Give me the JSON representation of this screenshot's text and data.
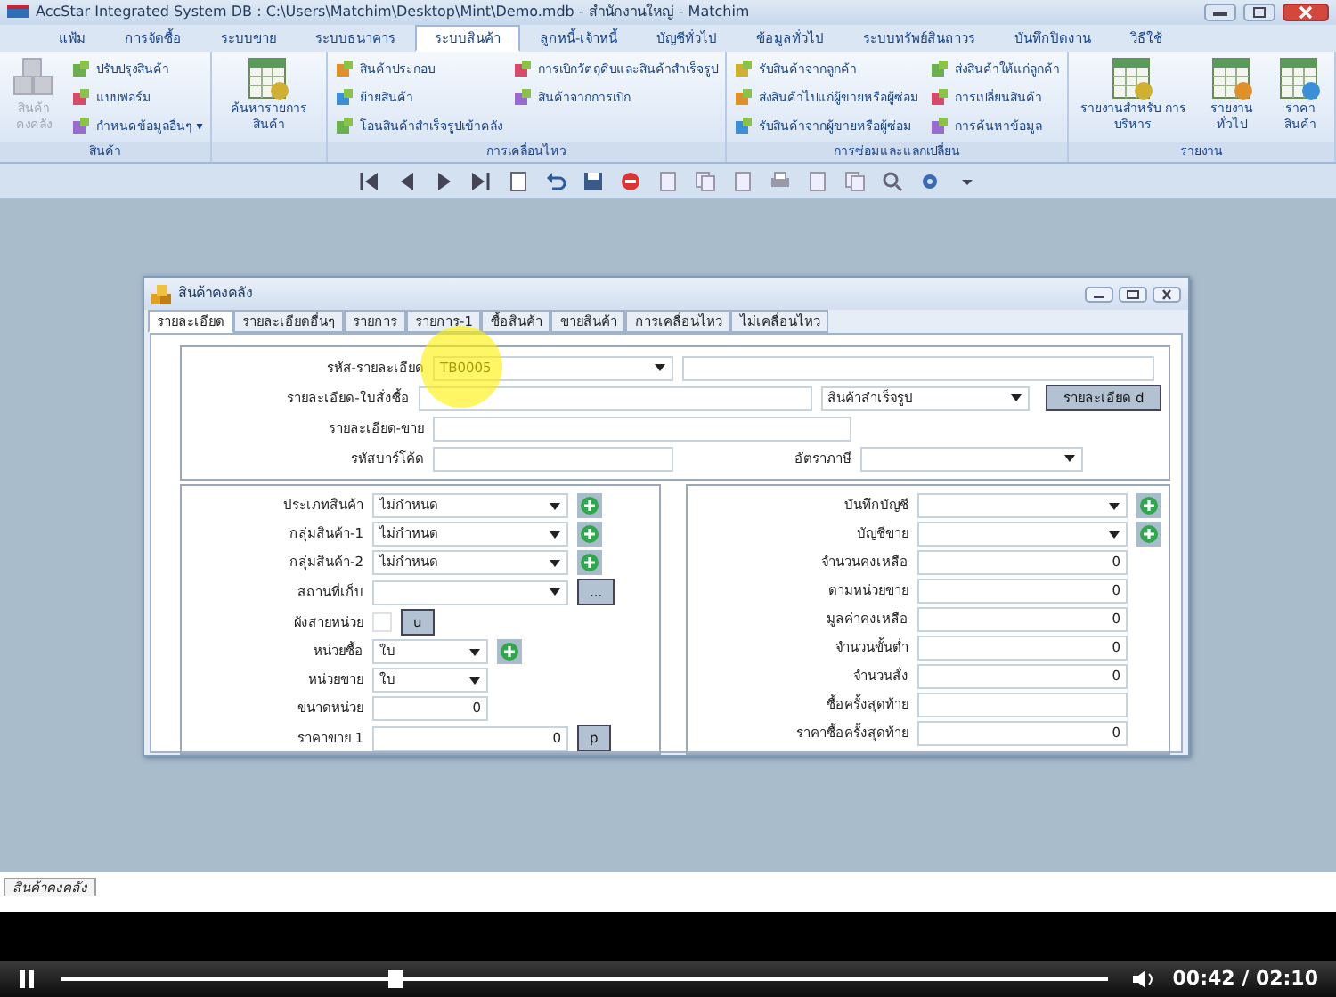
{
  "window": {
    "title": "AccStar Integrated System DB : C:\\Users\\Matchim\\Desktop\\Mint\\Demo.mdb - สำนักงานใหญ่ - Matchim"
  },
  "ribbon": {
    "tabs": [
      {
        "label": "แฟ้ม",
        "selected": false
      },
      {
        "label": "การจัดซื้อ",
        "selected": false
      },
      {
        "label": "ระบบขาย",
        "selected": false
      },
      {
        "label": "ระบบธนาคาร",
        "selected": false
      },
      {
        "label": "ระบบสินค้า",
        "selected": true
      },
      {
        "label": "ลูกหนี้-เจ้าหนี้",
        "selected": false
      },
      {
        "label": "บัญชีทั่วไป",
        "selected": false
      },
      {
        "label": "ข้อมูลทั่วไป",
        "selected": false
      },
      {
        "label": "ระบบทรัพย์สินถาวร",
        "selected": false
      },
      {
        "label": "บันทึกปิดงาน",
        "selected": false
      },
      {
        "label": "วิธีใช้",
        "selected": false
      }
    ],
    "groups": [
      {
        "label": "สินค้า",
        "items": [
          {
            "kind": "large",
            "label": "สินค้าคงคลัง",
            "disabled": true
          },
          {
            "kind": "small",
            "label": "ปรับปรุงสินค้า",
            "disabled": false
          },
          {
            "kind": "small",
            "label": "แบบฟอร์ม",
            "disabled": false
          },
          {
            "kind": "small",
            "label": "กำหนดข้อมูลอื่นๆ ▾",
            "disabled": false
          }
        ]
      },
      {
        "items": [
          {
            "kind": "large",
            "label": "ค้นหารายการสินค้า",
            "disabled": false
          }
        ]
      },
      {
        "label": "การเคลื่อนไหว",
        "items": [
          {
            "kind": "small",
            "label": "สินค้าประกอบ",
            "disabled": false
          },
          {
            "kind": "small",
            "label": "ย้ายสินค้า",
            "disabled": false
          },
          {
            "kind": "small",
            "label": "โอนสินค้าสำเร็จรูปเข้าคลัง",
            "disabled": false
          },
          {
            "kind": "small",
            "label": "การเบิกวัตถุดิบและสินค้าสำเร็จรูป",
            "disabled": false
          },
          {
            "kind": "small",
            "label": "สินค้าจากการเบิก",
            "disabled": false
          }
        ]
      },
      {
        "label": "การซ่อมและแลกเปลี่ยน",
        "items": [
          {
            "kind": "small",
            "label": "รับสินค้าจากลูกค้า",
            "disabled": false
          },
          {
            "kind": "small",
            "label": "ส่งสินค้าไปแก่ผู้ขายหรือผู้ซ่อม",
            "disabled": false
          },
          {
            "kind": "small",
            "label": "รับสินค้าจากผู้ขายหรือผู้ซ่อม",
            "disabled": false
          },
          {
            "kind": "small",
            "label": "ส่งสินค้าให้แก่ลูกค้า",
            "disabled": false
          },
          {
            "kind": "small",
            "label": "การเปลี่ยนสินค้า",
            "disabled": false
          },
          {
            "kind": "small",
            "label": "การค้นหาข้อมูล",
            "disabled": false
          }
        ]
      },
      {
        "label": "รายงาน",
        "items": [
          {
            "kind": "large",
            "label": "รายงานสำหรับ การบริหาร",
            "disabled": false
          },
          {
            "kind": "large",
            "label": "รายงานทั่วไป",
            "disabled": false
          },
          {
            "kind": "large",
            "label": "ราคาสินค้า",
            "disabled": false
          }
        ]
      }
    ]
  },
  "dialog": {
    "title": "สินค้าคงคลัง",
    "tabs": [
      {
        "label": "รายละเอียด",
        "selected": true
      },
      {
        "label": "รายละเอียดอื่นๆ",
        "selected": false
      },
      {
        "label": "รายการ",
        "selected": false
      },
      {
        "label": "รายการ-1",
        "selected": false
      },
      {
        "label": "ซื้อสินค้า",
        "selected": false
      },
      {
        "label": "ขายสินค้า",
        "selected": false
      },
      {
        "label": "การเคลื่อนไหว",
        "selected": false
      },
      {
        "label": "ไม่เคลื่อนไหว",
        "selected": false
      }
    ],
    "code": {
      "label": "รหัส-รายละเอียด",
      "value": "TB0005"
    },
    "purchase_description": {
      "label": "รายละเอียด-ใบสั่งซื้อ"
    },
    "category": {
      "value": "สินค้าสำเร็จรูป"
    },
    "detail_button": "รายละเอียด d",
    "sales_description": {
      "label": "รายละเอียด-ขาย"
    },
    "barcode": {
      "label": "รหัสบาร์โค้ด"
    },
    "tax_rate": {
      "label": "อัตราภาษี"
    },
    "left_panel": [
      {
        "kind": "combo",
        "label": "ประเภทสินค้า",
        "value": "ไม่กำหนด",
        "add_button": true
      },
      {
        "kind": "combo",
        "label": "กลุ่มสินค้า-1",
        "value": "ไม่กำหนด",
        "add_button": true
      },
      {
        "kind": "combo",
        "label": "กลุ่มสินค้า-2",
        "value": "ไม่กำหนด",
        "add_button": true
      },
      {
        "kind": "combo",
        "label": "สถานที่เก็บ",
        "button": "..."
      },
      {
        "kind": "check",
        "label": "ผังสายหน่วย",
        "checked": false,
        "button": "u"
      },
      {
        "kind": "short_combo",
        "label": "หน่วยซื้อ",
        "value": "ใบ",
        "add_button": true
      },
      {
        "kind": "short_combo",
        "label": "หน่วยขาย",
        "value": "ใบ"
      },
      {
        "kind": "short_number",
        "label": "ขนาดหน่วย",
        "value": "0"
      },
      {
        "kind": "number",
        "label": "ราคาขาย 1",
        "value": "0",
        "button": "p"
      }
    ],
    "right_panel": [
      {
        "kind": "combo",
        "label": "บันทึกบัญชี",
        "add_button": true
      },
      {
        "kind": "combo",
        "label": "บัญชีขาย",
        "add_button": true
      },
      {
        "kind": "number",
        "label": "จำนวนคงเหลือ",
        "value": "0"
      },
      {
        "kind": "number",
        "label": "ตามหน่วยขาย",
        "value": "0"
      },
      {
        "kind": "number",
        "label": "มูลค่าคงเหลือ",
        "value": "0"
      },
      {
        "kind": "number",
        "label": "จำนวนขั้นต่ำ",
        "value": "0"
      },
      {
        "kind": "number",
        "label": "จำนวนสั่ง",
        "value": "0"
      },
      {
        "kind": "text",
        "label": "ซื้อครั้งสุดท้าย"
      },
      {
        "kind": "number",
        "label": "ราคาซื้อครั้งสุดท้าย",
        "value": "0"
      }
    ]
  },
  "status_bar": {
    "tab": "สินค้าคงคลัง"
  },
  "player": {
    "playing": true,
    "level": 0.32,
    "time": "00:42 / 02:10"
  }
}
